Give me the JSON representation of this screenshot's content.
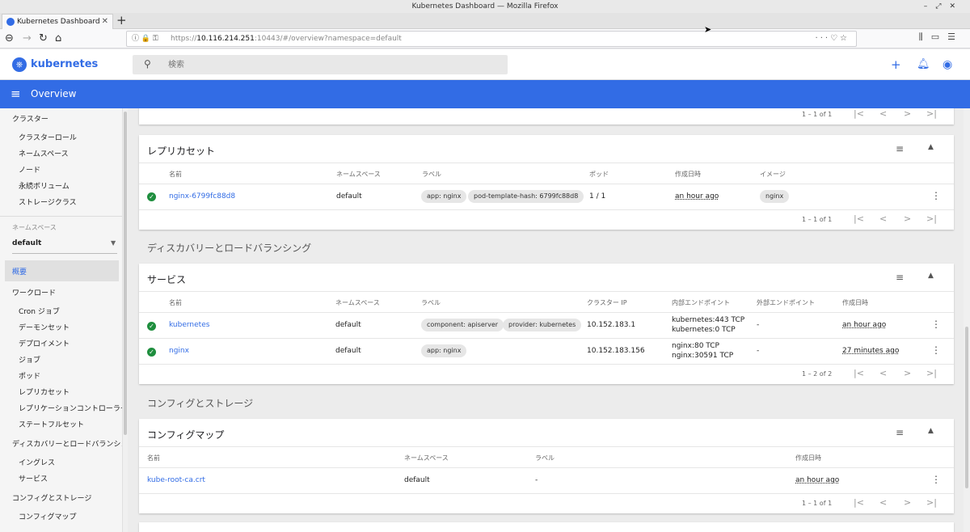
{
  "window": {
    "title": "Kubernetes Dashboard — Mozilla Firefox"
  },
  "browser": {
    "tab_title": "Kubernetes Dashboard",
    "url_prefix": "https://",
    "url_host": "10.116.214.251",
    "url_rest": ":10443/#/overview?namespace=default"
  },
  "app": {
    "brand": "kubernetes",
    "search_placeholder": "検索",
    "page_title": "Overview",
    "accent_color": "#326ce5"
  },
  "sidebar": {
    "cluster_header": "クラスター",
    "cluster_items": [
      "クラスターロール",
      "ネームスペース",
      "ノード",
      "永続ボリューム",
      "ストレージクラス"
    ],
    "namespace_label": "ネームスペース",
    "namespace_value": "default",
    "overview": "概要",
    "workload_header": "ワークロード",
    "workload_items": [
      "Cron ジョブ",
      "デーモンセット",
      "デプロイメント",
      "ジョブ",
      "ポッド",
      "レプリカセット",
      "レプリケーションコントローラー",
      "ステートフルセット"
    ],
    "discovery_header": "ディスカバリーとロードバランシング",
    "discovery_items": [
      "イングレス",
      "サービス"
    ],
    "config_header": "コンフィグとストレージ",
    "config_items": [
      "コンフィグマップ"
    ]
  },
  "top_pager": {
    "range": "1 – 1 of 1"
  },
  "replicasets": {
    "title": "レプリカセット",
    "columns": [
      "名前",
      "ネームスペース",
      "ラベル",
      "ポッド",
      "作成日時",
      "イメージ"
    ],
    "rows": [
      {
        "name": "nginx-6799fc88d8",
        "namespace": "default",
        "labels": [
          "app: nginx",
          "pod-template-hash: 6799fc88d8"
        ],
        "pods": "1 / 1",
        "created": "an hour ago",
        "image": "nginx"
      }
    ],
    "pager": "1 – 1 of 1"
  },
  "discovery_section": "ディスカバリーとロードバランシング",
  "services": {
    "title": "サービス",
    "columns": [
      "名前",
      "ネームスペース",
      "ラベル",
      "クラスター IP",
      "内部エンドポイント",
      "外部エンドポイント",
      "作成日時"
    ],
    "rows": [
      {
        "name": "kubernetes",
        "namespace": "default",
        "labels": [
          "component: apiserver",
          "provider: kubernetes"
        ],
        "cluster_ip": "10.152.183.1",
        "internal": [
          "kubernetes:443 TCP",
          "kubernetes:0 TCP"
        ],
        "external": "-",
        "created": "an hour ago"
      },
      {
        "name": "nginx",
        "namespace": "default",
        "labels": [
          "app: nginx"
        ],
        "cluster_ip": "10.152.183.156",
        "internal": [
          "nginx:80 TCP",
          "nginx:30591 TCP"
        ],
        "external": "-",
        "created": "27 minutes ago"
      }
    ],
    "pager": "1 – 2 of 2"
  },
  "config_section": "コンフィグとストレージ",
  "configmaps": {
    "title": "コンフィグマップ",
    "columns": [
      "名前",
      "ネームスペース",
      "ラベル",
      "作成日時"
    ],
    "rows": [
      {
        "name": "kube-root-ca.crt",
        "namespace": "default",
        "labels": "-",
        "created": "an hour ago"
      }
    ],
    "pager": "1 – 1 of 1"
  }
}
